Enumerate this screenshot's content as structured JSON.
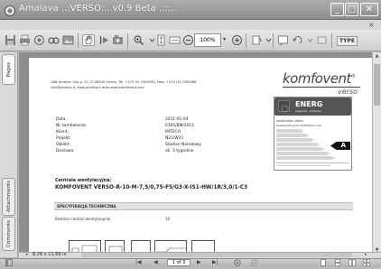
{
  "window": {
    "title": "Amalava ..:VERSO:.. v0.9 Beta ..::..",
    "min_glyph": "_",
    "max_glyph": "□",
    "close_glyph": "✕",
    "close_doc_glyph": "×"
  },
  "toolbar": {
    "zoom_value": "100%",
    "zoom_arrow": "▾",
    "text_button_label": "TYPE"
  },
  "sidebar": {
    "tabs": [
      {
        "label": "Pages"
      },
      {
        "label": "Attachments"
      },
      {
        "label": "Comments"
      }
    ]
  },
  "document": {
    "contact_lines": [
      "UAB Amalva, Ozo g. 10, LT-08200 Vilnius, Tel. +370 (5) 2300595, Faks. +370 (5) 2300588",
      "info@amalva.lt, www.amalva.lt arba www.komfovent.com"
    ],
    "logo": "komfovent",
    "logo_registered": "®",
    "logo_sub": "verso",
    "energy_label": {
      "title": "ENERG",
      "subtitle": "енергия · ενέργεια",
      "brand_line": "KOMFOVENT VERSO",
      "url_line": "www.komfovent-certification.com",
      "class": "A"
    },
    "meta": [
      {
        "label": "Data:",
        "value": "2011-01-04"
      },
      {
        "label": "Nr zamówienia:",
        "value": "0365/BM/2011"
      },
      {
        "label": "Klient:",
        "value": "IMTECH"
      },
      {
        "label": "Projekt:",
        "value": "N21/W21"
      },
      {
        "label": "Obiekt:",
        "value": "Stadion Narodowy"
      },
      {
        "label": "Dostawa:",
        "value": "ok. 3 tygodnie"
      }
    ],
    "unit_heading": "Centrala wentylacyjna:",
    "unit_model": "KOMFOVENT VERSO-R-10-M-7,5/0,75-F5/G3-X-IS1-HW/1R/3,0/1-C3",
    "spec_title": "SPECYFIKACJA TECHNICZNA",
    "spec_rows": [
      {
        "label": "Rozmiar centrali wentylacyjnej",
        "value": "10"
      }
    ],
    "page_size": "8,26 x 11,69 in"
  },
  "statusbar": {
    "first_glyph": "|◀",
    "prev_glyph": "◀",
    "page_display": "1 of 3",
    "next_glyph": "▶",
    "last_glyph": "▶|"
  }
}
